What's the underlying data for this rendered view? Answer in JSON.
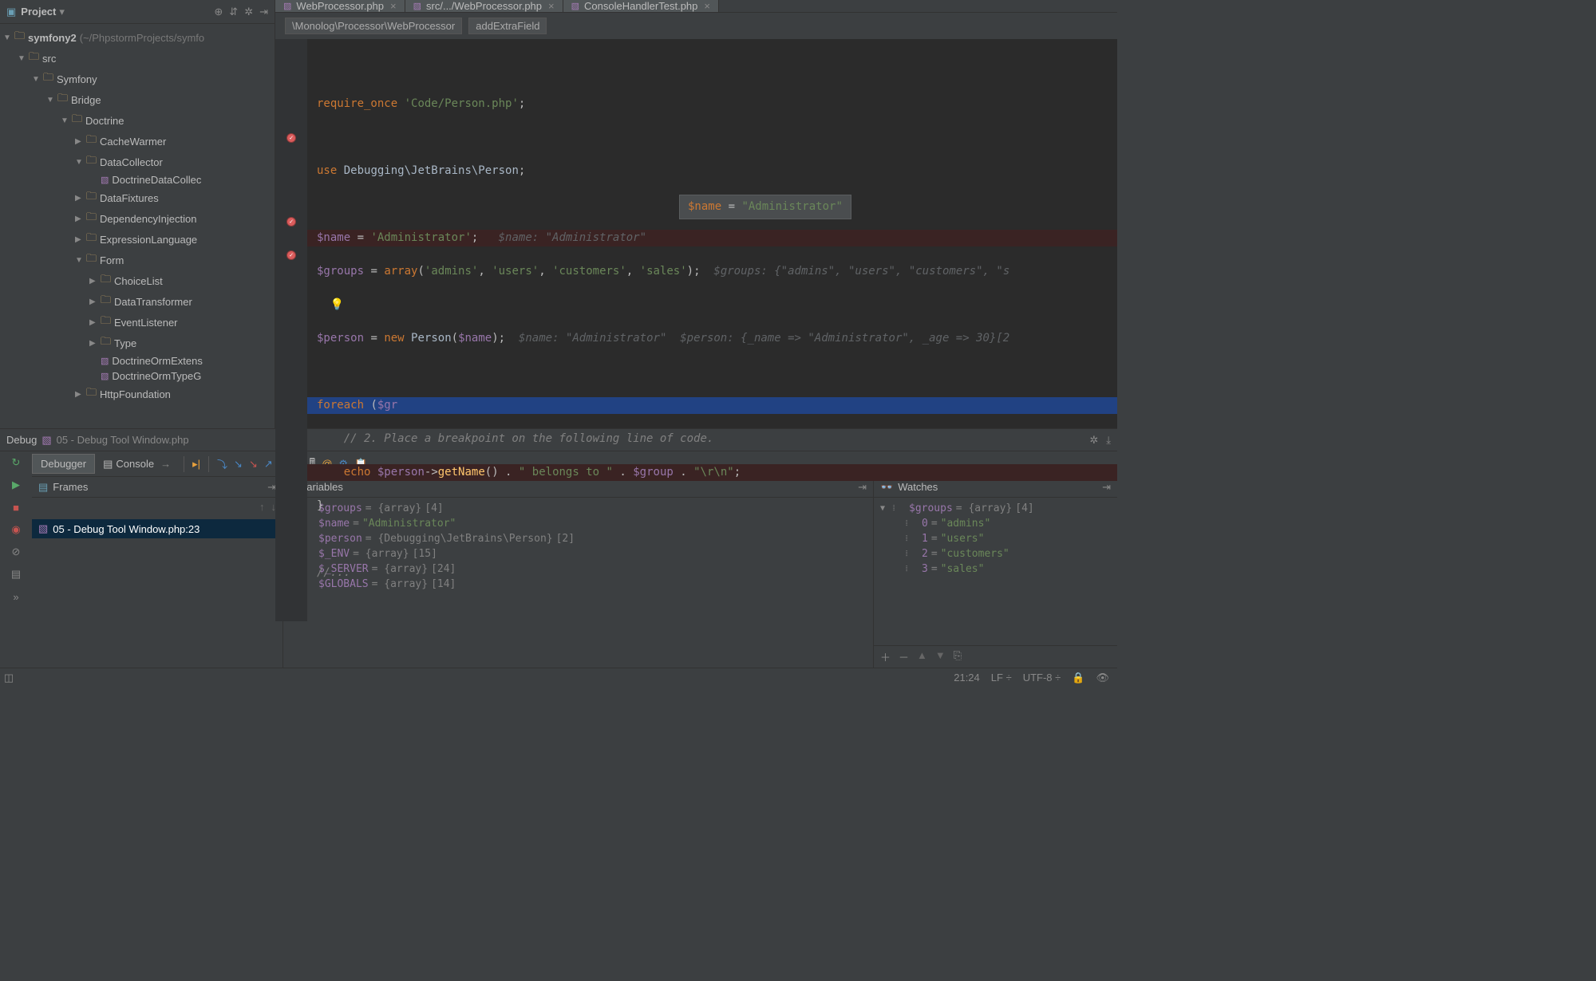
{
  "sidebar": {
    "title": "Project",
    "root": {
      "label": "symfony2",
      "hint": "(~/PhpstormProjects/symfo"
    },
    "tree": [
      {
        "indent": 1,
        "arrow": "▼",
        "icon": "folder",
        "label": "src"
      },
      {
        "indent": 2,
        "arrow": "▼",
        "icon": "folder",
        "label": "Symfony"
      },
      {
        "indent": 3,
        "arrow": "▼",
        "icon": "folder",
        "label": "Bridge"
      },
      {
        "indent": 4,
        "arrow": "▼",
        "icon": "folder",
        "label": "Doctrine"
      },
      {
        "indent": 5,
        "arrow": "▶",
        "icon": "folder",
        "label": "CacheWarmer"
      },
      {
        "indent": 5,
        "arrow": "▼",
        "icon": "folder",
        "label": "DataCollector"
      },
      {
        "indent": 6,
        "arrow": "",
        "icon": "php",
        "label": "DoctrineDataCollec"
      },
      {
        "indent": 5,
        "arrow": "▶",
        "icon": "folder",
        "label": "DataFixtures"
      },
      {
        "indent": 5,
        "arrow": "▶",
        "icon": "folder",
        "label": "DependencyInjection"
      },
      {
        "indent": 5,
        "arrow": "▶",
        "icon": "folder",
        "label": "ExpressionLanguage"
      },
      {
        "indent": 5,
        "arrow": "▼",
        "icon": "folder",
        "label": "Form"
      },
      {
        "indent": 6,
        "arrow": "▶",
        "icon": "folder",
        "label": "ChoiceList"
      },
      {
        "indent": 6,
        "arrow": "▶",
        "icon": "folder",
        "label": "DataTransformer"
      },
      {
        "indent": 6,
        "arrow": "▶",
        "icon": "folder",
        "label": "EventListener"
      },
      {
        "indent": 6,
        "arrow": "▶",
        "icon": "folder",
        "label": "Type"
      },
      {
        "indent": 6,
        "arrow": "",
        "icon": "php",
        "label": "DoctrineOrmExtens"
      },
      {
        "indent": 6,
        "arrow": "",
        "icon": "php",
        "label": "DoctrineOrmTypeG"
      },
      {
        "indent": 5,
        "arrow": "▶",
        "icon": "folder",
        "label": "HttpFoundation"
      }
    ]
  },
  "tabs": [
    {
      "label": "WebProcessor.php",
      "active": false
    },
    {
      "label": "src/.../WebProcessor.php",
      "active": false
    },
    {
      "label": "ConsoleHandlerTest.php",
      "active": false
    }
  ],
  "breadcrumbs": [
    "\\Monolog\\Processor\\WebProcessor",
    "addExtraField"
  ],
  "tooltip": {
    "var": "$name",
    "eq": " = ",
    "val": "\"Administrator\""
  },
  "debug": {
    "title": "Debug",
    "run_config": "05 - Debug Tool Window.php",
    "tabs": {
      "debugger": "Debugger",
      "console": "Console"
    },
    "frames_title": "Frames",
    "variables_title": "Variables",
    "watches_title": "Watches",
    "frame": "05 - Debug Tool Window.php:23",
    "variables": [
      {
        "arrow": "▶",
        "name": "$groups",
        "type": " = {array} ",
        "extra": "[4]"
      },
      {
        "arrow": "",
        "name": "$name",
        "type": " = ",
        "val": "\"Administrator\""
      },
      {
        "arrow": "▶",
        "name": "$person",
        "type": " = {Debugging\\JetBrains\\Person} ",
        "extra": "[2]"
      },
      {
        "arrow": "▶",
        "name": "$_ENV",
        "type": " = {array} ",
        "extra": "[15]"
      },
      {
        "arrow": "▶",
        "name": "$_SERVER",
        "type": " = {array} ",
        "extra": "[24]"
      },
      {
        "arrow": "▶",
        "name": "$GLOBALS",
        "type": " = {array} ",
        "extra": "[14]"
      }
    ],
    "watches": {
      "root": {
        "name": "$groups",
        "type": " = {array} ",
        "extra": "[4]"
      },
      "items": [
        {
          "key": "0",
          "val": "\"admins\""
        },
        {
          "key": "1",
          "val": "\"users\""
        },
        {
          "key": "2",
          "val": "\"customers\""
        },
        {
          "key": "3",
          "val": "\"sales\""
        }
      ]
    }
  },
  "status": {
    "pos": "21:24",
    "lineend": "LF",
    "encoding": "UTF-8"
  }
}
